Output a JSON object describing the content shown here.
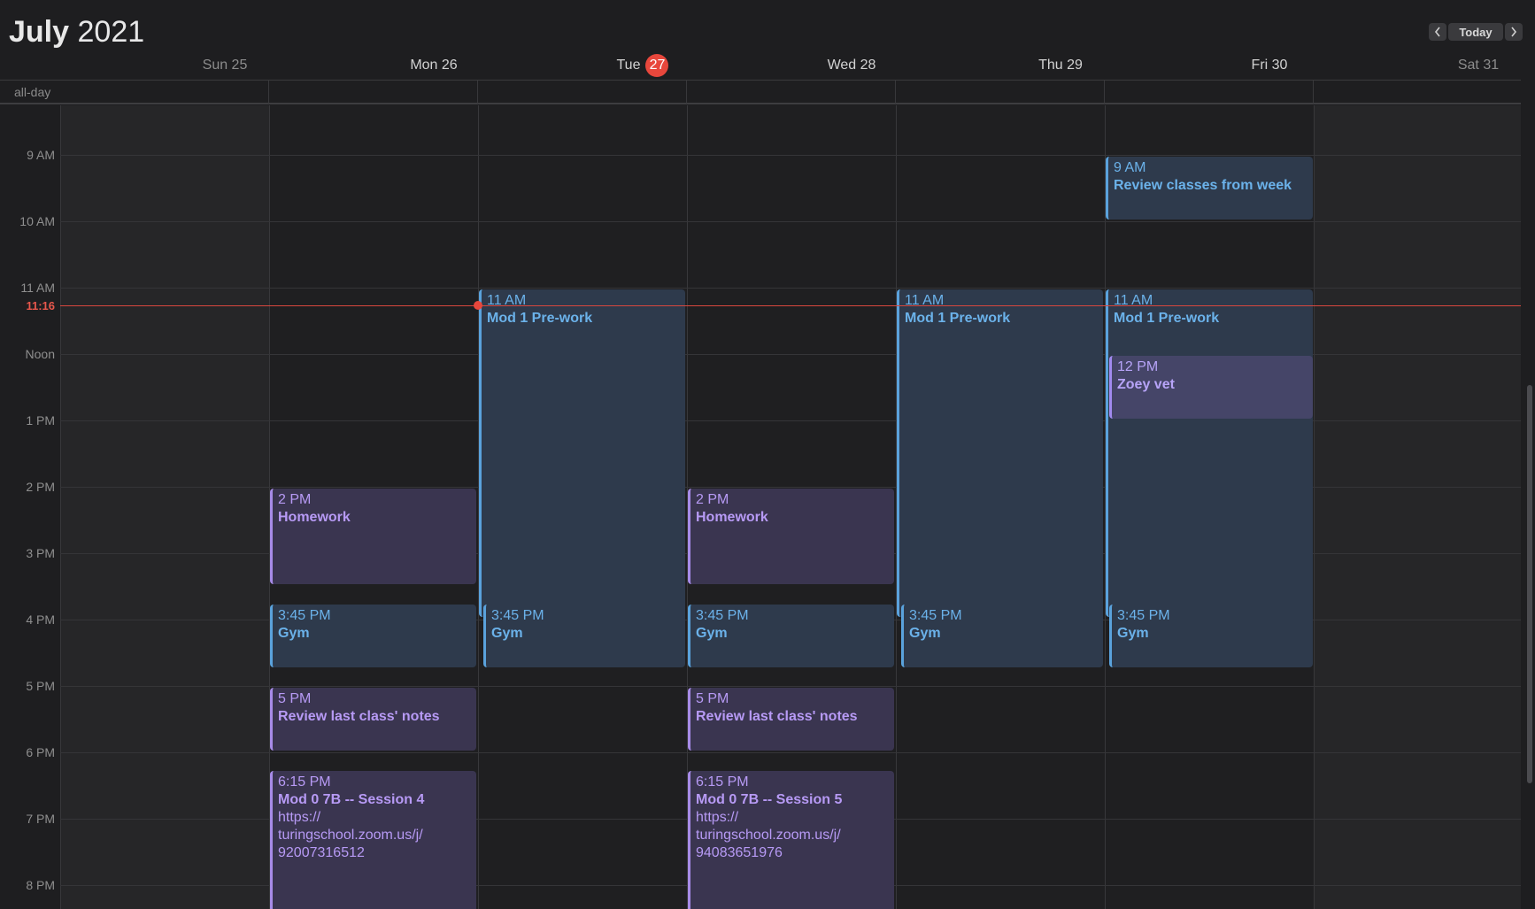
{
  "header": {
    "month": "July",
    "year": "2021",
    "today_label": "Today",
    "prev_icon": "chevron-left-icon",
    "next_icon": "chevron-right-icon"
  },
  "days": [
    {
      "label": "Sun 25",
      "weekend": true
    },
    {
      "label": "Mon 26",
      "weekend": false
    },
    {
      "label": "Tue",
      "number": "27",
      "today": true,
      "weekend": false
    },
    {
      "label": "Wed 28",
      "weekend": false
    },
    {
      "label": "Thu 29",
      "weekend": false
    },
    {
      "label": "Fri 30",
      "weekend": false
    },
    {
      "label": "Sat 31",
      "weekend": true
    }
  ],
  "allday_label": "all-day",
  "hours": [
    "9 AM",
    "10 AM",
    "11 AM",
    "Noon",
    "1 PM",
    "2 PM",
    "3 PM",
    "4 PM",
    "5 PM",
    "6 PM",
    "7 PM",
    "8 PM"
  ],
  "current_time": "11:16",
  "events": {
    "fri_review": {
      "time": "9 AM",
      "name": "Review classes from week"
    },
    "tue_prework": {
      "time": "11 AM",
      "name": "Mod 1 Pre-work"
    },
    "thu_prework": {
      "time": "11 AM",
      "name": "Mod 1 Pre-work"
    },
    "fri_prework": {
      "time": "11 AM",
      "name": "Mod 1 Pre-work"
    },
    "fri_vet": {
      "time": "12 PM",
      "name": "Zoey vet"
    },
    "mon_homework": {
      "time": "2 PM",
      "name": "Homework"
    },
    "wed_homework": {
      "time": "2 PM",
      "name": "Homework"
    },
    "mon_gym": {
      "time": "3:45 PM",
      "name": "Gym"
    },
    "tue_gym": {
      "time": "3:45 PM",
      "name": "Gym"
    },
    "wed_gym": {
      "time": "3:45 PM",
      "name": "Gym"
    },
    "thu_gym": {
      "time": "3:45 PM",
      "name": "Gym"
    },
    "fri_gym": {
      "time": "3:45 PM",
      "name": "Gym"
    },
    "mon_notes": {
      "time": "5 PM",
      "name": "Review last class' notes"
    },
    "wed_notes": {
      "time": "5 PM",
      "name": "Review last class' notes"
    },
    "mon_session": {
      "time": "6:15 PM",
      "name": "Mod 0 7B -- Session 4",
      "link1": "https://",
      "link2": "turingschool.zoom.us/j/",
      "link3": "92007316512"
    },
    "wed_session": {
      "time": "6:15 PM",
      "name": "Mod 0 7B -- Session 5",
      "link1": "https://",
      "link2": "turingschool.zoom.us/j/",
      "link3": "94083651976"
    }
  },
  "colors": {
    "blue_event": "#5aa2dc",
    "purple_event": "#a78be8",
    "now_indicator": "#e8473c"
  }
}
